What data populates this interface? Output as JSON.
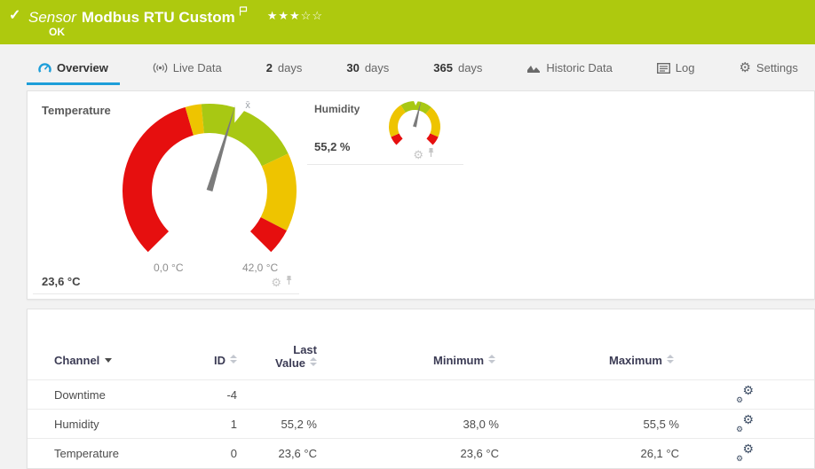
{
  "colors": {
    "header_green": "#aec90e",
    "tab_blue": "#1d9ed9",
    "red": "#e60f0f",
    "yellow": "#eec400",
    "green": "#a8c813",
    "needle": "#7b7b7b"
  },
  "header": {
    "check": "✓",
    "kind": "Sensor",
    "title": "Modbus RTU Custom",
    "status": "OK",
    "stars_filled": "★★★",
    "stars_empty": "☆☆"
  },
  "tabs": [
    {
      "label": "Overview",
      "icon": "gauge",
      "active": true
    },
    {
      "label": "Live Data",
      "icon": "broadcast"
    },
    {
      "num": "2",
      "label": "days"
    },
    {
      "num": "30",
      "label": "days"
    },
    {
      "num": "365",
      "label": "days"
    },
    {
      "label": "Historic Data",
      "icon": "chart"
    },
    {
      "label": "Log",
      "icon": "log"
    },
    {
      "label": "Settings",
      "icon": "gear"
    }
  ],
  "overview": {
    "gauges": [
      {
        "name": "Temperature",
        "value_label": "23,6 °C",
        "value_fraction": 0.562,
        "scale_min": "0,0 °C",
        "scale_max": "42,0 °C",
        "mean_fraction": 0.575,
        "mean_label": "x̄",
        "segments": [
          [
            0,
            0.44,
            "red"
          ],
          [
            0.44,
            0.48,
            "yellow"
          ],
          [
            0.48,
            0.74,
            "green"
          ],
          [
            0.74,
            0.935,
            "yellow"
          ],
          [
            0.935,
            1,
            "red"
          ]
        ]
      },
      {
        "name": "Humidity",
        "value_label": "55,2 %",
        "value_fraction": 0.552,
        "mean_fraction": 0.51,
        "mean_label": "",
        "segments": [
          [
            0,
            0.08,
            "red"
          ],
          [
            0.08,
            0.38,
            "yellow"
          ],
          [
            0.38,
            0.65,
            "green"
          ],
          [
            0.65,
            0.92,
            "yellow"
          ],
          [
            0.92,
            1,
            "red"
          ]
        ]
      }
    ]
  },
  "table": {
    "headers": {
      "channel": "Channel",
      "id": "ID",
      "last_line1": "Last",
      "last_line2": "Value",
      "min": "Minimum",
      "max": "Maximum"
    },
    "rows": [
      {
        "channel": "Downtime",
        "id": "-4",
        "last": "",
        "min": "",
        "max": ""
      },
      {
        "channel": "Humidity",
        "id": "1",
        "last": "55,2 %",
        "min": "38,0 %",
        "max": "55,5 %"
      },
      {
        "channel": "Temperature",
        "id": "0",
        "last": "23,6 °C",
        "min": "23,6 °C",
        "max": "26,1 °C"
      }
    ]
  }
}
